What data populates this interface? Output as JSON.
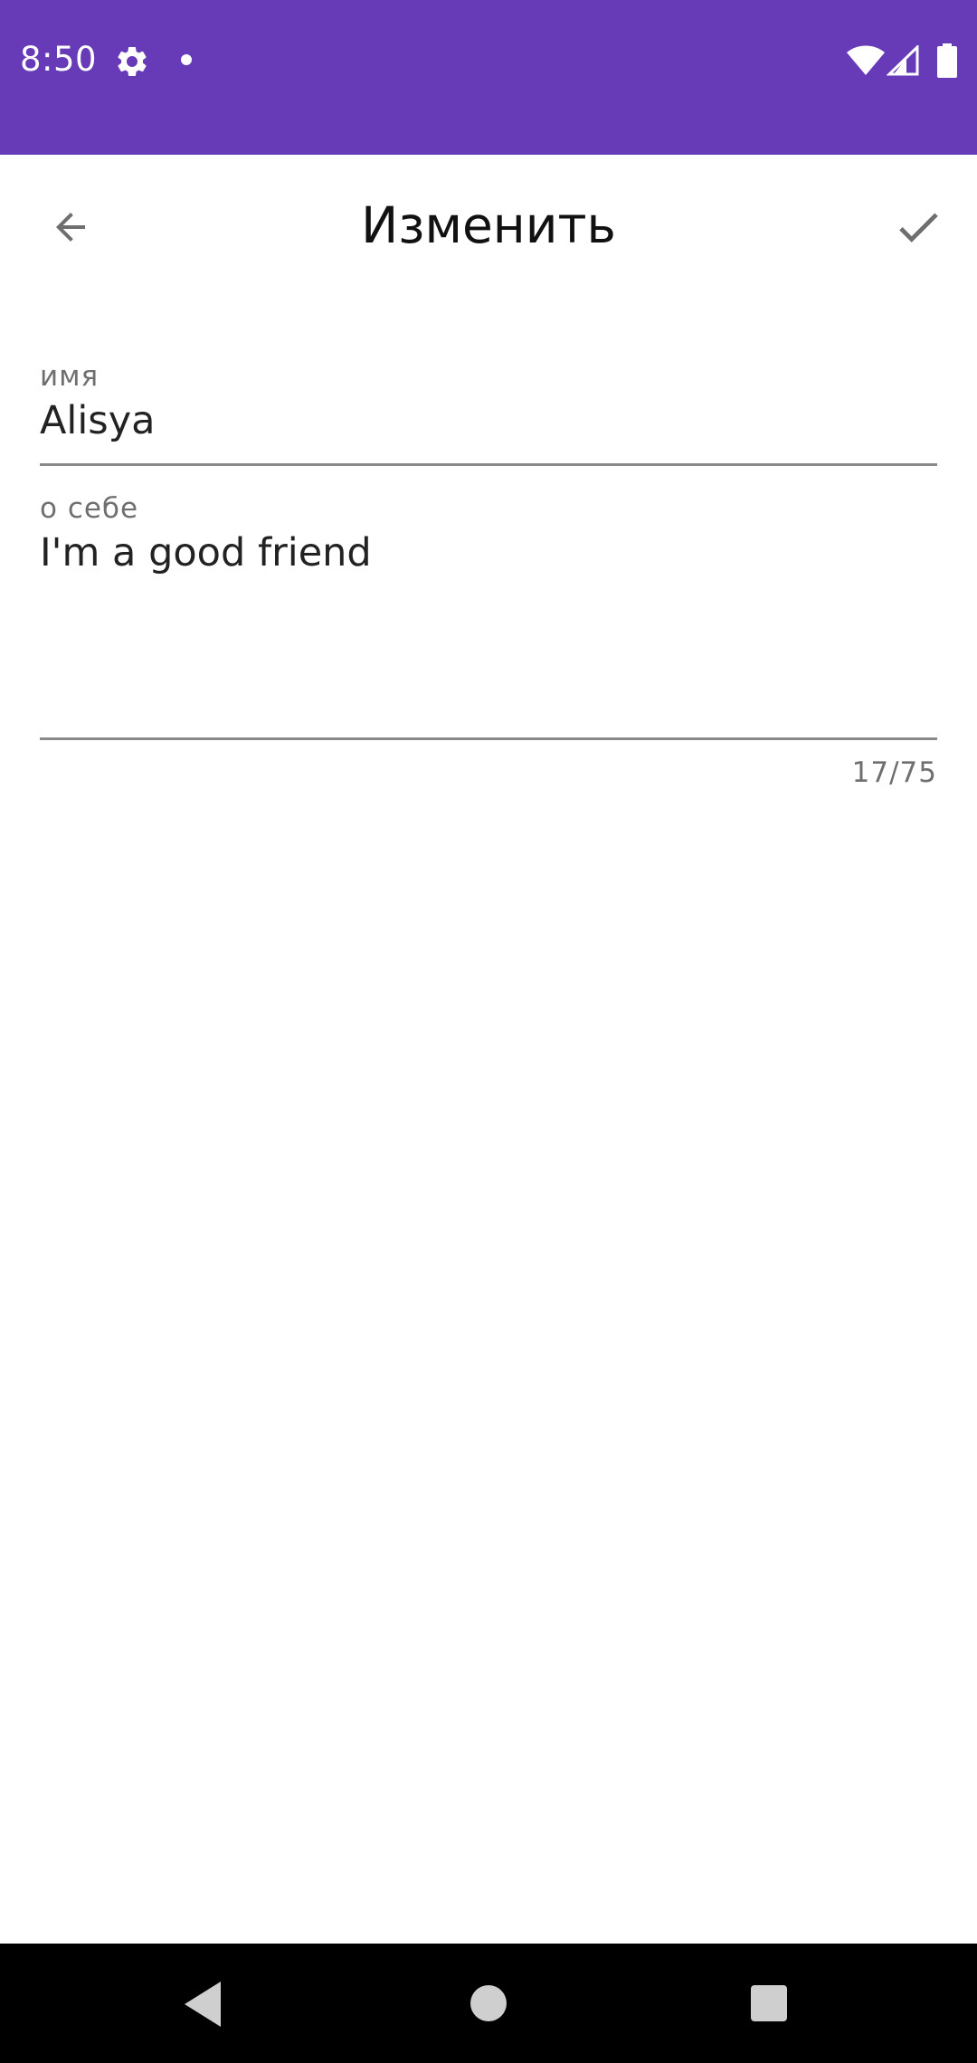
{
  "status_bar": {
    "time": "8:50",
    "background": "#673ab7",
    "icons": [
      "gear-icon",
      "notification-dot-icon",
      "wifi-icon",
      "signal-icon",
      "battery-icon"
    ]
  },
  "app_bar": {
    "title": "Изменить",
    "back_icon": "arrow-back-icon",
    "confirm_icon": "check-icon"
  },
  "form": {
    "name": {
      "label": "имя",
      "value": "Alisya"
    },
    "about": {
      "label": "о себе",
      "value": "I'm a good friend",
      "counter": "17/75"
    }
  },
  "nav_bar": {
    "icons": [
      "nav-back-icon",
      "nav-home-icon",
      "nav-recents-icon"
    ]
  }
}
